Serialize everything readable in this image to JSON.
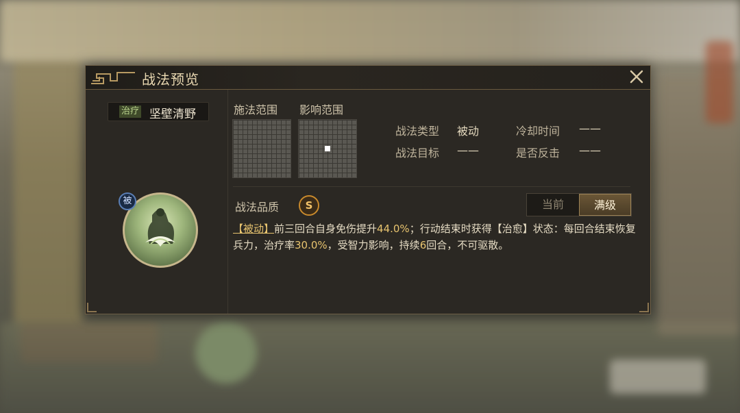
{
  "dialog": {
    "title": "战法预览"
  },
  "skill": {
    "tag": "治疗",
    "name": "坚壁清野",
    "badge": "被"
  },
  "ranges": {
    "cast_label": "施法范围",
    "effect_label": "影响范围"
  },
  "info": {
    "type_label": "战法类型",
    "type_value": "被动",
    "cooldown_label": "冷却时间",
    "cooldown_value": "——",
    "target_label": "战法目标",
    "target_value": "——",
    "counter_label": "是否反击",
    "counter_value": "——"
  },
  "quality": {
    "label": "战法品质",
    "grade": "S"
  },
  "level_toggle": {
    "current": "当前",
    "max": "满级"
  },
  "description": {
    "kw1": "【被动】",
    "t1": "前三回合自身免伤提升",
    "n1": "44.0%",
    "t2": "；行动结束时获得【治愈】状态：每回合结束恢复兵力，治疗率",
    "n2": "30.0%",
    "t3": "，受智力影响，持续",
    "n3": "6",
    "t4": "回合，不可驱散。"
  },
  "colors": {
    "accent": "#e8c46f",
    "panel": "#2b2823",
    "title_text": "#ead9b2"
  }
}
